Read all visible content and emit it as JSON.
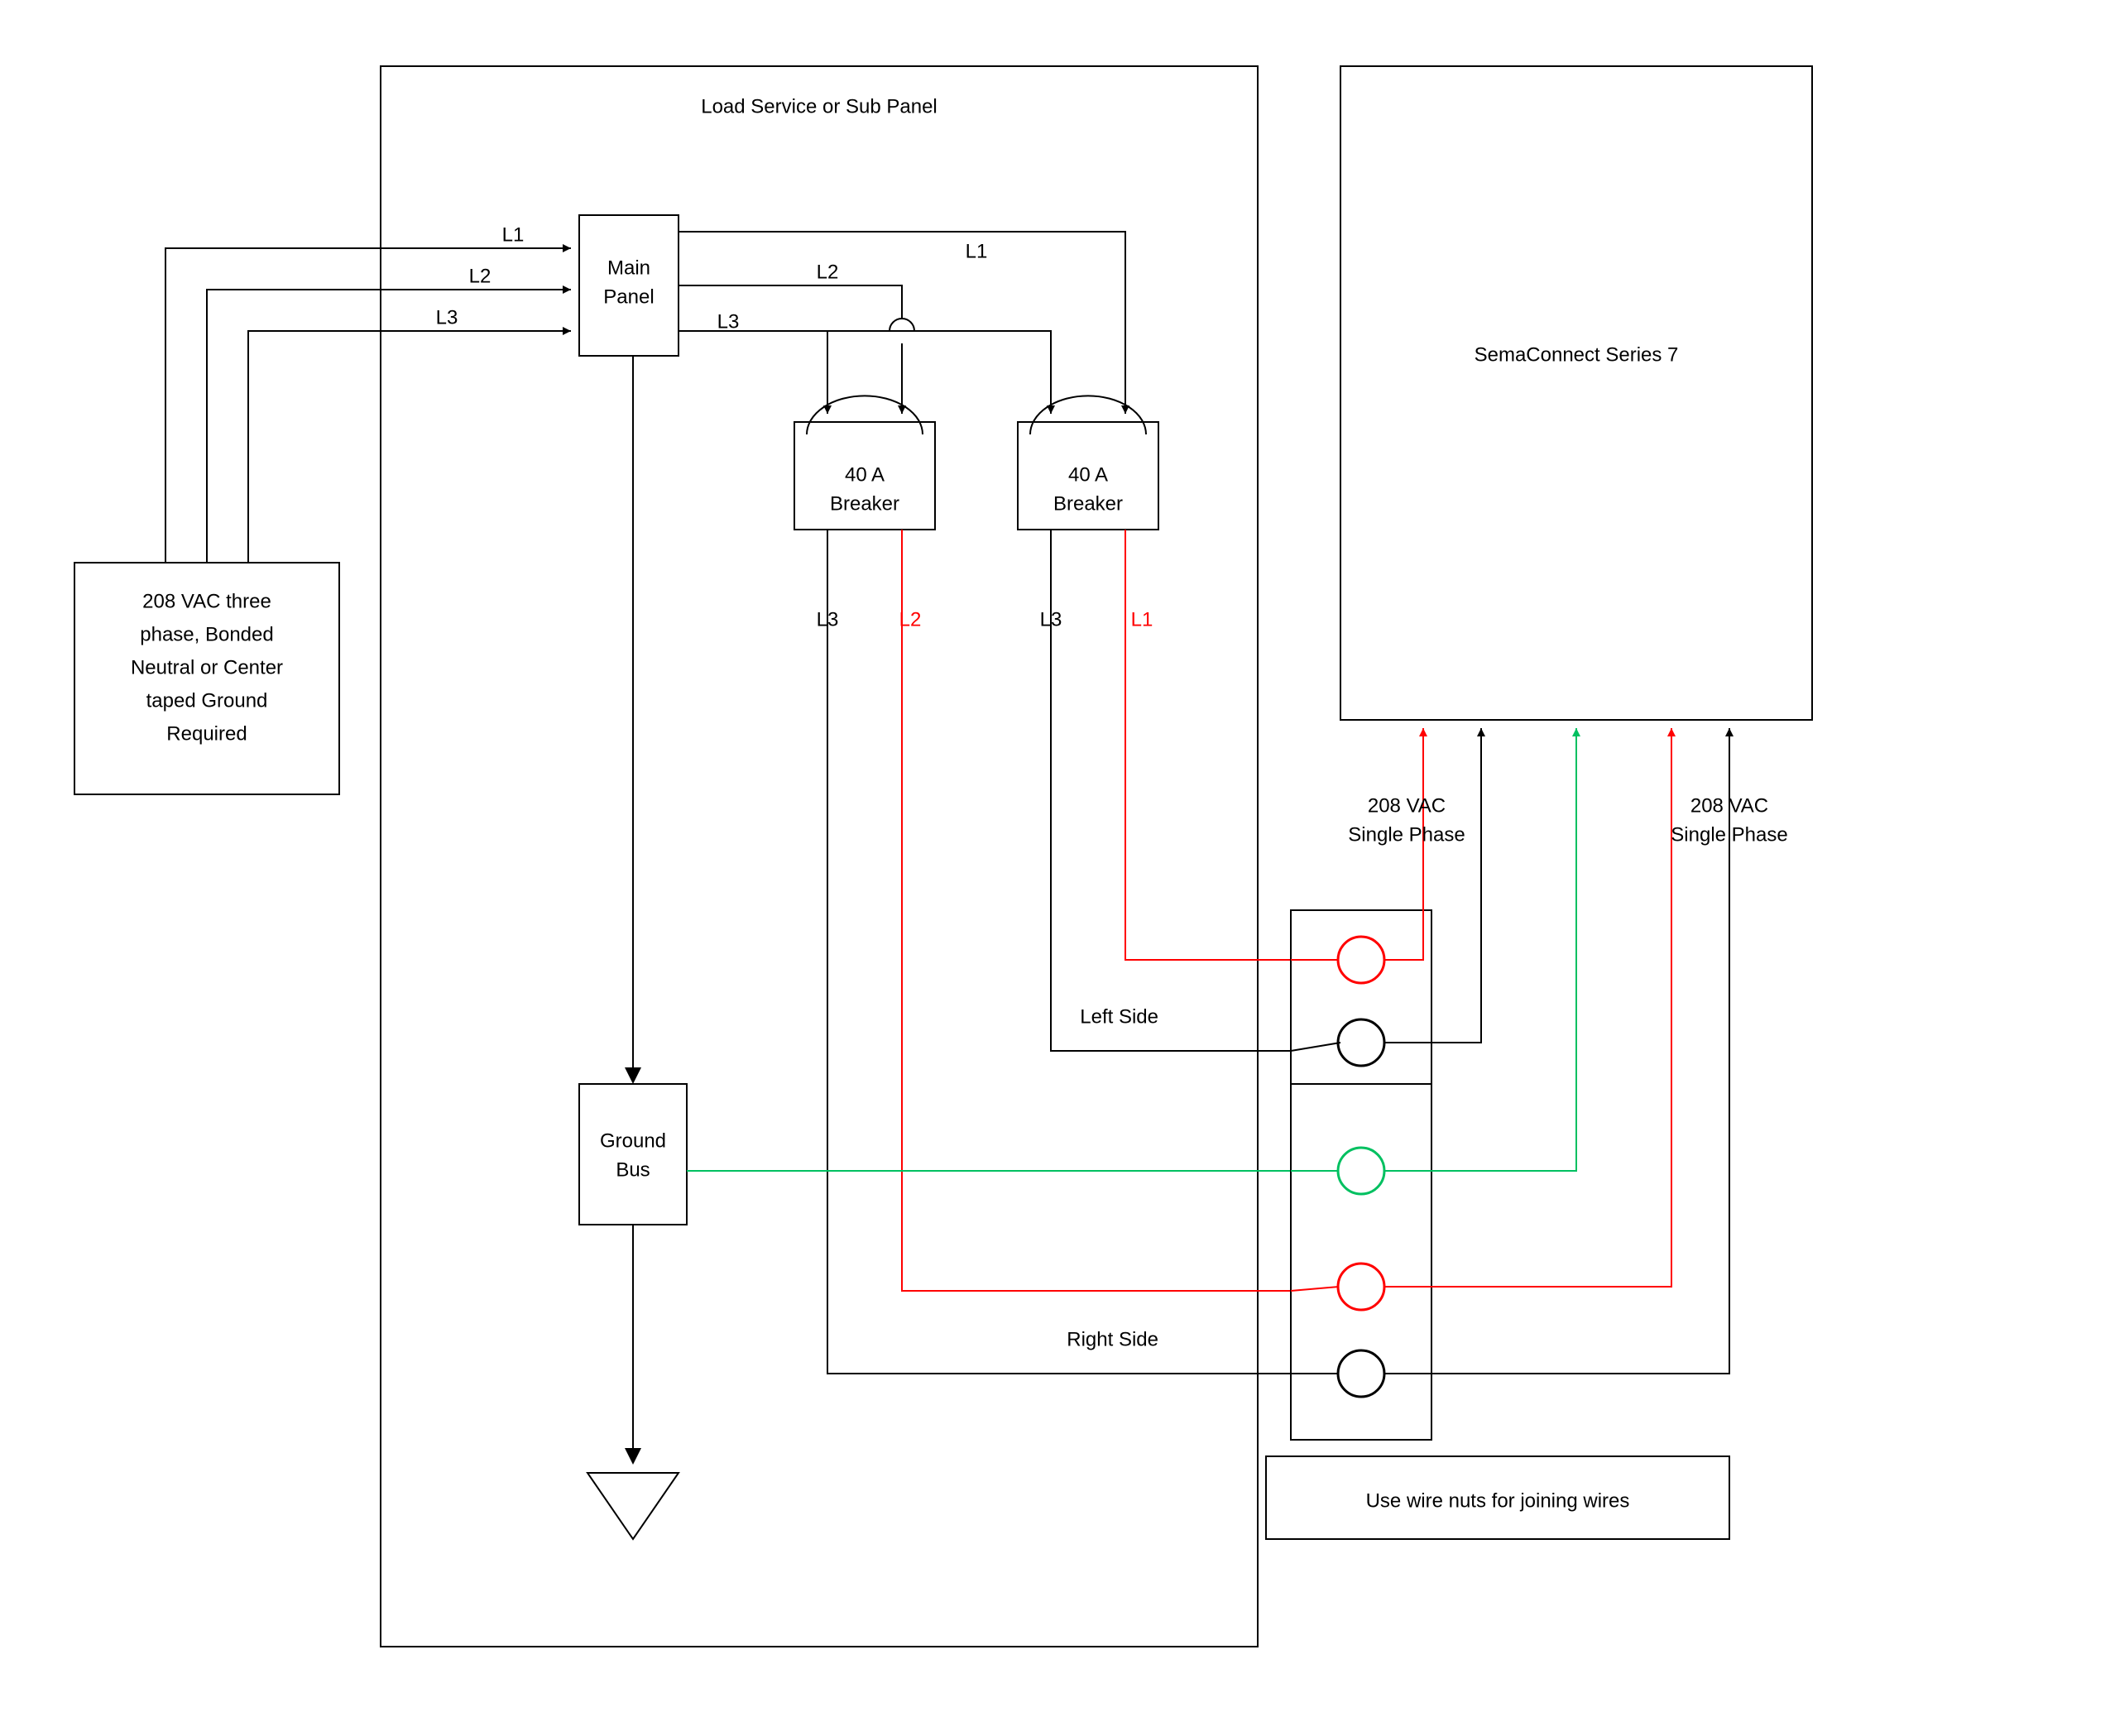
{
  "panel": {
    "title": "Load Service or Sub Panel",
    "main_panel": "Main Panel",
    "main_panel_l1": "Main",
    "main_panel_l2": "Panel",
    "breaker1_line1": "40 A",
    "breaker1_line2": "Breaker",
    "breaker2_line1": "40 A",
    "breaker2_line2": "Breaker",
    "ground_bus_l1": "Ground",
    "ground_bus_l2": "Bus"
  },
  "source": {
    "line1": "208 VAC three",
    "line2": "phase, Bonded",
    "line3": "Neutral or Center",
    "line4": "taped Ground",
    "line5": "Required"
  },
  "lines": {
    "L1": "L1",
    "L2": "L2",
    "L3": "L3"
  },
  "device": {
    "title": "SemaConnect Series 7",
    "out1_l1": "208 VAC",
    "out1_l2": "Single Phase",
    "out2_l1": "208 VAC",
    "out2_l2": "Single Phase"
  },
  "junction": {
    "left_side": "Left Side",
    "right_side": "Right Side",
    "note": "Use wire nuts for joining wires"
  }
}
